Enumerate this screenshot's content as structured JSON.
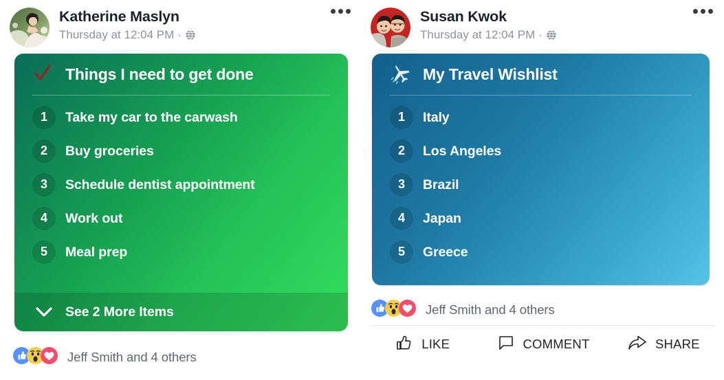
{
  "posts": [
    {
      "author": "Katherine Maslyn",
      "timestamp": "Thursday at 12:04 PM",
      "privacy_icon": "globe-icon",
      "more_icon": "more-options-icon",
      "avatar_alt": "katherine-avatar",
      "list": {
        "title": "Things I need to get done",
        "title_icon": "check-mark-icon",
        "accent_start": "#0a6d58",
        "accent_end": "#34dd5d",
        "items": [
          {
            "number": "1",
            "label": "Take my car to the carwash"
          },
          {
            "number": "2",
            "label": "Buy groceries"
          },
          {
            "number": "3",
            "label": "Schedule dentist appointment"
          },
          {
            "number": "4",
            "label": "Work out"
          },
          {
            "number": "5",
            "label": "Meal prep"
          }
        ],
        "see_more_label": "See 2 More Items",
        "see_more_icon": "chevron-down-icon"
      },
      "reactions": {
        "icons": [
          "like-icon",
          "wow-icon",
          "love-icon"
        ],
        "text": "Jeff Smith and 4 others"
      },
      "actions": []
    },
    {
      "author": "Susan Kwok",
      "timestamp": "Thursday at 12:04 PM",
      "privacy_icon": "globe-icon",
      "more_icon": "more-options-icon",
      "avatar_alt": "susan-avatar",
      "list": {
        "title": "My Travel Wishlist",
        "title_icon": "airplane-icon",
        "accent_start": "#13608c",
        "accent_end": "#53c3e6",
        "items": [
          {
            "number": "1",
            "label": "Italy"
          },
          {
            "number": "2",
            "label": "Los Angeles"
          },
          {
            "number": "3",
            "label": "Brazil"
          },
          {
            "number": "4",
            "label": "Japan"
          },
          {
            "number": "5",
            "label": "Greece"
          }
        ],
        "see_more_label": "",
        "see_more_icon": ""
      },
      "reactions": {
        "icons": [
          "like-icon",
          "wow-icon",
          "love-icon"
        ],
        "text": "Jeff Smith and 4 others"
      },
      "actions": [
        {
          "label": "LIKE",
          "icon": "thumbs-up-outline-icon"
        },
        {
          "label": "COMMENT",
          "icon": "comment-bubble-icon"
        },
        {
          "label": "SHARE",
          "icon": "share-arrow-icon"
        }
      ]
    }
  ],
  "colors": {
    "reaction_like_blue": "#5890ff",
    "reaction_wow_yellow": "#f7ce4c",
    "reaction_love_red": "#f24e6c",
    "text_primary": "#1d2129",
    "text_secondary": "#8d949e",
    "divider": "#e4e6eb"
  }
}
